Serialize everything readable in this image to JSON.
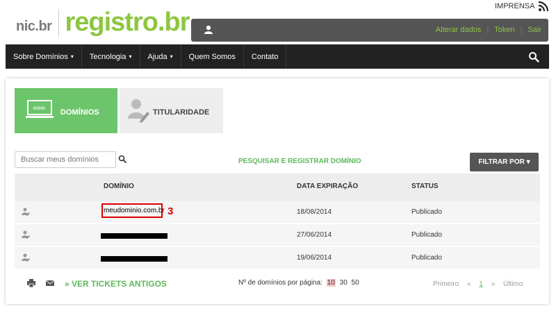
{
  "header": {
    "logo_nic": "nic.br",
    "logo_registro": "registro.br",
    "imprensa": "IMPRENSA",
    "user_links": [
      "Alterar dados",
      "Token",
      "Sair"
    ]
  },
  "nav": {
    "items": [
      {
        "label": "Sobre Domínios",
        "caret": "▾"
      },
      {
        "label": "Tecnologia",
        "caret": "▾"
      },
      {
        "label": "Ajuda",
        "caret": "▾"
      },
      {
        "label": "Quem Somos",
        "caret": ""
      },
      {
        "label": "Contato",
        "caret": ""
      }
    ]
  },
  "tabs": {
    "dominios": {
      "label": "DOMÍNIOS",
      "icon_text": "www."
    },
    "titularidade": {
      "label": "TITULARIDADE"
    }
  },
  "search": {
    "placeholder": "Buscar meus domínios"
  },
  "pesquisar_label": "PESQUISAR E REGISTRAR DOMÍNIO",
  "filtrar_label": "FILTRAR POR ▾",
  "table": {
    "headers": {
      "dominio": "DOMÍNIO",
      "expiracao": "DATA EXPIRAÇÃO",
      "status": "STATUS"
    },
    "rows": [
      {
        "domain": "meudominio.com.br",
        "expiration": "18/08/2014",
        "status": "Publicado",
        "annotation": "3"
      },
      {
        "domain": "",
        "expiration": "27/06/2014",
        "status": "Publicado"
      },
      {
        "domain": "",
        "expiration": "19/06/2014",
        "status": "Publicado"
      }
    ]
  },
  "footer": {
    "ver_tickets": "» VER TICKETS ANTIGOS",
    "per_page_label": "Nº de domínios por página:",
    "per_page_options": [
      "10",
      "30",
      "50"
    ],
    "per_page_selected": "10",
    "pager": {
      "first": "Primeiro",
      "prev": "«",
      "current": "1",
      "next": "»",
      "last": "Último"
    }
  },
  "colors": {
    "brand_green": "#8cc63f",
    "tab_green": "#6cc56b",
    "annotation_red": "#dd0000"
  }
}
